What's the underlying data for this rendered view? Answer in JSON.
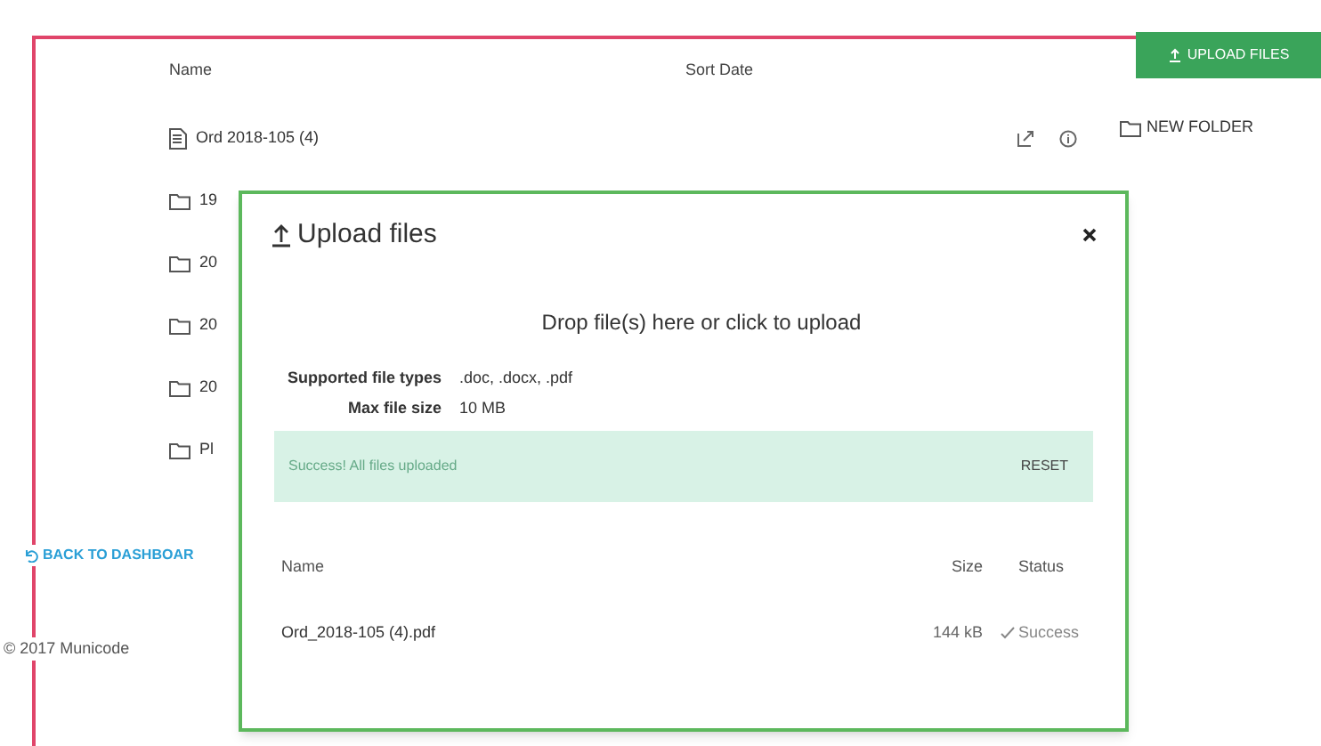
{
  "file_list": {
    "columns": [
      "Name",
      "Sort Date"
    ],
    "rows": [
      {
        "kind": "file",
        "name": "Ord 2018-105 (4)"
      },
      {
        "kind": "folder",
        "name": "19"
      },
      {
        "kind": "folder",
        "name": "20"
      },
      {
        "kind": "folder",
        "name": "20"
      },
      {
        "kind": "folder",
        "name": "20"
      },
      {
        "kind": "folder",
        "name": "Pl"
      }
    ]
  },
  "actions": {
    "upload_button": "UPLOAD FILES",
    "new_folder": "NEW FOLDER"
  },
  "back_link": "BACK TO DASHBOAR",
  "footer": "© 2017 Municode",
  "modal": {
    "title": "Upload files",
    "drop_text": "Drop file(s) here or click to upload",
    "info": [
      {
        "label": "Supported file types",
        "value": ".doc, .docx, .pdf"
      },
      {
        "label": "Max file size",
        "value": "10 MB"
      }
    ],
    "progress": {
      "text": "Success! All files uploaded",
      "button": "RESET"
    },
    "table": {
      "columns": [
        "Name",
        "Size",
        "Status"
      ],
      "rows": [
        {
          "name": "Ord_2018-105 (4).pdf",
          "size": "144 kB",
          "status": "Success"
        }
      ]
    }
  }
}
